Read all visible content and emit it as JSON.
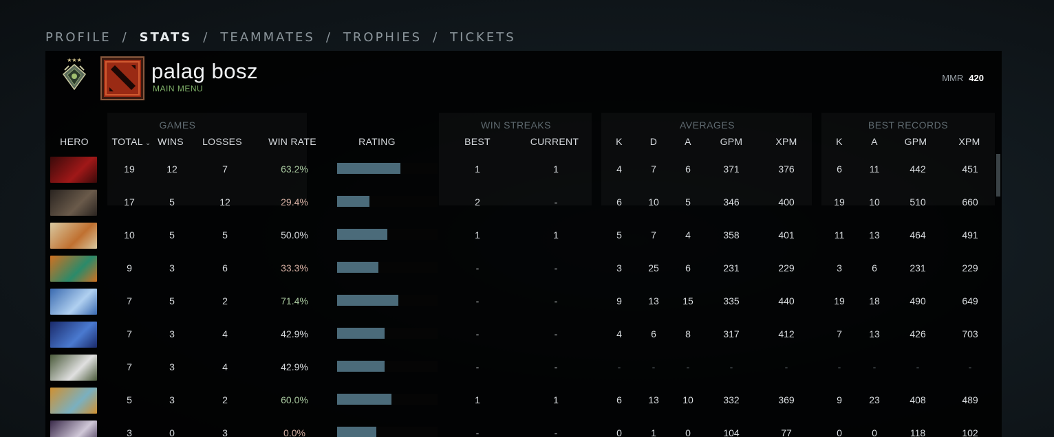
{
  "nav": {
    "tabs": [
      "PROFILE",
      "STATS",
      "TEAMMATES",
      "TROPHIES",
      "TICKETS"
    ],
    "active": "STATS",
    "separator": "/"
  },
  "player": {
    "name": "palag bosz",
    "status": "MAIN MENU",
    "mmr_label": "MMR",
    "mmr_value": "420",
    "rank_icon": "rank-medal-icon",
    "avatar_icon": "dota-logo-icon"
  },
  "groups": {
    "games": "GAMES",
    "win_streaks": "WIN STREAKS",
    "averages": "AVERAGES",
    "best_records": "BEST RECORDS"
  },
  "columns": {
    "hero": "HERO",
    "total": "TOTAL",
    "wins": "WINS",
    "losses": "LOSSES",
    "win_rate": "WIN RATE",
    "rating": "RATING",
    "best": "BEST",
    "current": "CURRENT",
    "avg_k": "K",
    "avg_d": "D",
    "avg_a": "A",
    "avg_gpm": "GPM",
    "avg_xpm": "XPM",
    "best_k": "K",
    "best_a": "A",
    "best_gpm": "GPM",
    "best_xpm": "XPM"
  },
  "colors": {
    "win_rate_good": "#a9c9a0",
    "win_rate_bad": "#d6b0a3",
    "rating_bar": "#4b6b7a",
    "status_green": "#7fb069"
  },
  "rows": [
    {
      "hero_icon": "hero-portrait-red-demon-icon",
      "hero_colors": [
        "#3a0a0a",
        "#a01818"
      ],
      "total": "19",
      "wins": "12",
      "losses": "7",
      "win_rate": "63.2%",
      "tone": "win",
      "rating": 0.63,
      "best": "1",
      "current": "1",
      "avg_k": "4",
      "avg_d": "7",
      "avg_a": "6",
      "avg_gpm": "371",
      "avg_xpm": "376",
      "best_k": "6",
      "best_a": "11",
      "best_gpm": "442",
      "best_xpm": "451"
    },
    {
      "hero_icon": "hero-portrait-bear-icon",
      "hero_colors": [
        "#2a2420",
        "#6a5a4a"
      ],
      "total": "17",
      "wins": "5",
      "losses": "12",
      "win_rate": "29.4%",
      "tone": "lose",
      "rating": 0.32,
      "best": "2",
      "current": "-",
      "avg_k": "6",
      "avg_d": "10",
      "avg_a": "5",
      "avg_gpm": "346",
      "avg_xpm": "400",
      "best_k": "19",
      "best_a": "10",
      "best_gpm": "510",
      "best_xpm": "660"
    },
    {
      "hero_icon": "hero-portrait-orange-warrior-icon",
      "hero_colors": [
        "#d8c8a0",
        "#c07030"
      ],
      "total": "10",
      "wins": "5",
      "losses": "5",
      "win_rate": "50.0%",
      "tone": "neutral",
      "rating": 0.5,
      "best": "1",
      "current": "1",
      "avg_k": "5",
      "avg_d": "7",
      "avg_a": "4",
      "avg_gpm": "358",
      "avg_xpm": "401",
      "best_k": "11",
      "best_a": "13",
      "best_gpm": "464",
      "best_xpm": "491"
    },
    {
      "hero_icon": "hero-portrait-green-goblin-icon",
      "hero_colors": [
        "#d07020",
        "#2a8a6a"
      ],
      "total": "9",
      "wins": "3",
      "losses": "6",
      "win_rate": "33.3%",
      "tone": "lose",
      "rating": 0.41,
      "best": "-",
      "current": "-",
      "avg_k": "3",
      "avg_d": "25",
      "avg_a": "6",
      "avg_gpm": "231",
      "avg_xpm": "229",
      "best_k": "3",
      "best_a": "6",
      "best_gpm": "231",
      "best_xpm": "229"
    },
    {
      "hero_icon": "hero-portrait-storm-mage-icon",
      "hero_colors": [
        "#3a6ab0",
        "#b0d0f0"
      ],
      "total": "7",
      "wins": "5",
      "losses": "2",
      "win_rate": "71.4%",
      "tone": "win",
      "rating": 0.61,
      "best": "-",
      "current": "-",
      "avg_k": "9",
      "avg_d": "13",
      "avg_a": "15",
      "avg_gpm": "335",
      "avg_xpm": "440",
      "best_k": "19",
      "best_a": "18",
      "best_gpm": "490",
      "best_xpm": "649"
    },
    {
      "hero_icon": "hero-portrait-blue-assassin-icon",
      "hero_colors": [
        "#1a2a6a",
        "#4a7ad0"
      ],
      "total": "7",
      "wins": "3",
      "losses": "4",
      "win_rate": "42.9%",
      "tone": "neutral",
      "rating": 0.47,
      "best": "-",
      "current": "-",
      "avg_k": "4",
      "avg_d": "6",
      "avg_a": "8",
      "avg_gpm": "317",
      "avg_xpm": "412",
      "best_k": "7",
      "best_a": "13",
      "best_gpm": "426",
      "best_xpm": "703"
    },
    {
      "hero_icon": "hero-portrait-bearded-tinker-icon",
      "hero_colors": [
        "#4a5a3a",
        "#e0e0e0"
      ],
      "total": "7",
      "wins": "3",
      "losses": "4",
      "win_rate": "42.9%",
      "tone": "neutral",
      "rating": 0.47,
      "best": "-",
      "current": "-",
      "avg_k": "-",
      "avg_d": "-",
      "avg_a": "-",
      "avg_gpm": "-",
      "avg_xpm": "-",
      "best_k": "-",
      "best_a": "-",
      "best_gpm": "-",
      "best_xpm": "-"
    },
    {
      "hero_icon": "hero-portrait-frost-lich-icon",
      "hero_colors": [
        "#d09030",
        "#7ab0c0"
      ],
      "total": "5",
      "wins": "3",
      "losses": "2",
      "win_rate": "60.0%",
      "tone": "win",
      "rating": 0.54,
      "best": "1",
      "current": "1",
      "avg_k": "6",
      "avg_d": "13",
      "avg_a": "10",
      "avg_gpm": "332",
      "avg_xpm": "369",
      "best_k": "9",
      "best_a": "23",
      "best_gpm": "408",
      "best_xpm": "489"
    },
    {
      "hero_icon": "hero-portrait-pale-spectre-icon",
      "hero_colors": [
        "#3a2a4a",
        "#d0c8d8"
      ],
      "total": "3",
      "wins": "0",
      "losses": "3",
      "win_rate": "0.0%",
      "tone": "lose",
      "rating": 0.39,
      "best": "-",
      "current": "-",
      "avg_k": "0",
      "avg_d": "1",
      "avg_a": "0",
      "avg_gpm": "104",
      "avg_xpm": "77",
      "best_k": "0",
      "best_a": "0",
      "best_gpm": "118",
      "best_xpm": "102"
    }
  ]
}
